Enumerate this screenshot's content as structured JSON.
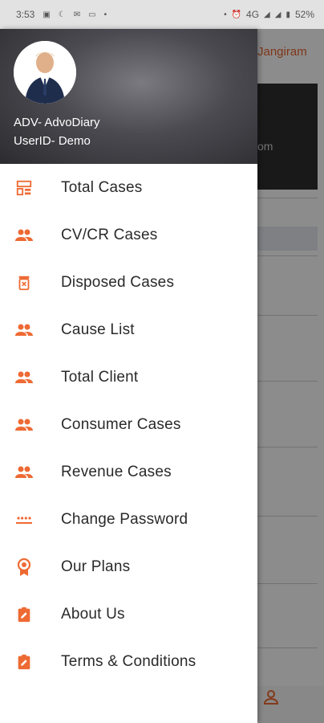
{
  "status_bar": {
    "time": "3:53",
    "network": "4G",
    "battery": "52%"
  },
  "background_app": {
    "title_fragment": "Jangiram",
    "card_text_fragment": "om"
  },
  "drawer": {
    "user_name": "ADV- AdvoDiary",
    "user_id": "UserID- Demo",
    "items": [
      {
        "label": "Total Cases",
        "icon": "dashboard-icon"
      },
      {
        "label": "CV/CR Cases",
        "icon": "people-icon"
      },
      {
        "label": "Disposed Cases",
        "icon": "delete-icon"
      },
      {
        "label": "Cause List",
        "icon": "people-icon"
      },
      {
        "label": "Total Client",
        "icon": "people-icon"
      },
      {
        "label": "Consumer Cases",
        "icon": "people-icon"
      },
      {
        "label": "Revenue Cases",
        "icon": "people-icon"
      },
      {
        "label": "Change Password",
        "icon": "password-icon"
      },
      {
        "label": "Our Plans",
        "icon": "badge-icon"
      },
      {
        "label": "About Us",
        "icon": "assignment-icon"
      },
      {
        "label": "Terms & Conditions",
        "icon": "assignment-icon"
      }
    ]
  },
  "colors": {
    "accent": "#ee6a33",
    "header_dark": "#2c2c30",
    "status_bar": "#e2e2e2"
  }
}
